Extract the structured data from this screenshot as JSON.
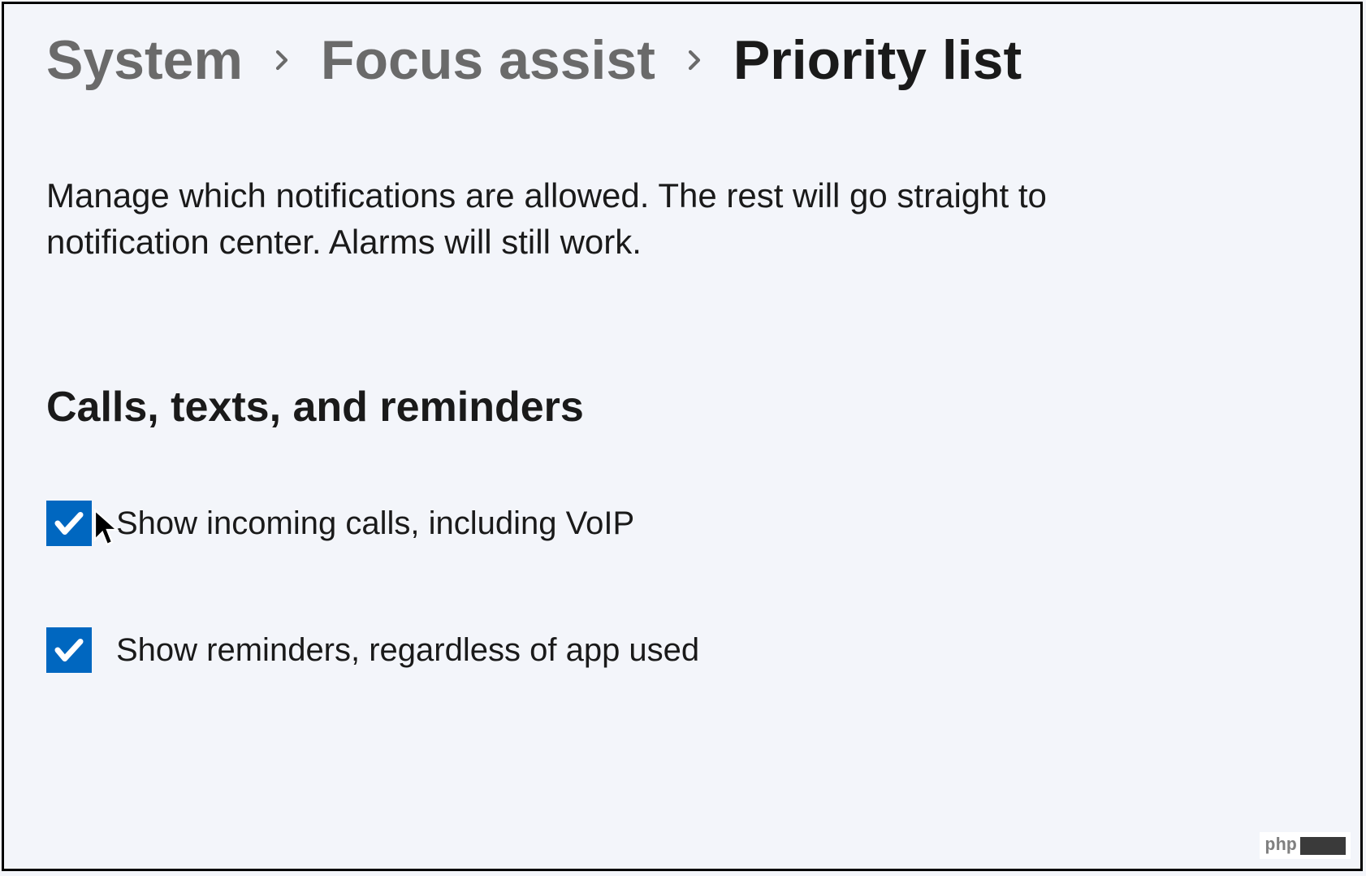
{
  "breadcrumb": {
    "items": [
      {
        "label": "System"
      },
      {
        "label": "Focus assist"
      }
    ],
    "current": "Priority list"
  },
  "description": "Manage which notifications are allowed. The rest will go straight to notification center. Alarms will still work.",
  "section": {
    "heading": "Calls, texts, and reminders",
    "checkboxes": [
      {
        "label": "Show incoming calls, including VoIP",
        "checked": true
      },
      {
        "label": "Show reminders, regardless of app used",
        "checked": true
      }
    ]
  },
  "watermark": {
    "text": "php"
  },
  "colors": {
    "accent": "#0067c0",
    "background": "#f3f5fa",
    "text_primary": "#1a1a1a",
    "text_muted": "#6a6a6a"
  }
}
